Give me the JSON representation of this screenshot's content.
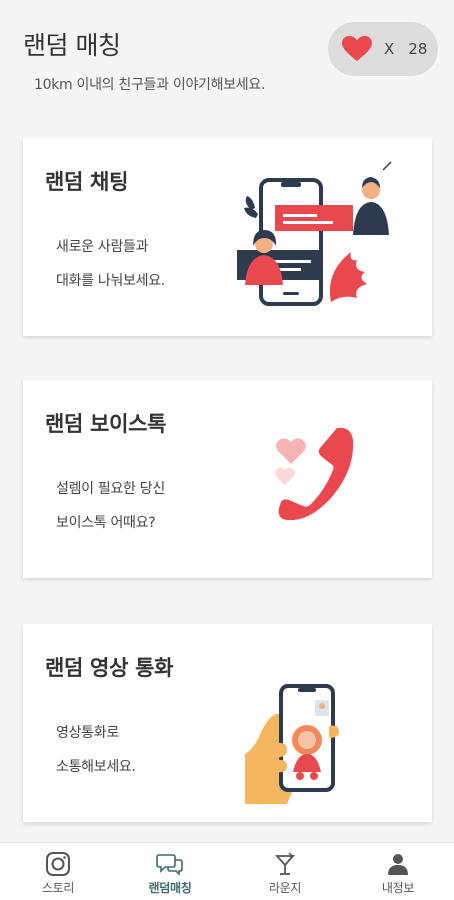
{
  "header": {
    "title": "랜덤 매칭",
    "subtitle": "10km 이내의 친구들과 이야기해보세요.",
    "hearts": {
      "prefix": "X",
      "count": "28",
      "icon": "heart-icon"
    }
  },
  "cards": [
    {
      "title": "랜덤 채팅",
      "line1": "새로운 사람들과",
      "line2": "대화를 나눠보세요.",
      "icon": "chat-illustration"
    },
    {
      "title": "랜덤 보이스톡",
      "line1": "설렘이 필요한 당신",
      "line2": "보이스톡 어때요?",
      "icon": "phone-illustration"
    },
    {
      "title": "랜덤 영상 통화",
      "line1": "영상통화로",
      "line2": "소통해보세요.",
      "icon": "video-call-illustration"
    }
  ],
  "nav": [
    {
      "label": "스토리",
      "icon": "story-icon"
    },
    {
      "label": "랜덤매칭",
      "icon": "chat-bubbles-icon",
      "active": true
    },
    {
      "label": "라운지",
      "icon": "cocktail-icon"
    },
    {
      "label": "내정보",
      "icon": "person-icon"
    }
  ],
  "colors": {
    "accent": "#e8484e",
    "background": "#f5f5f5",
    "active_nav": "#3f6b6b"
  }
}
